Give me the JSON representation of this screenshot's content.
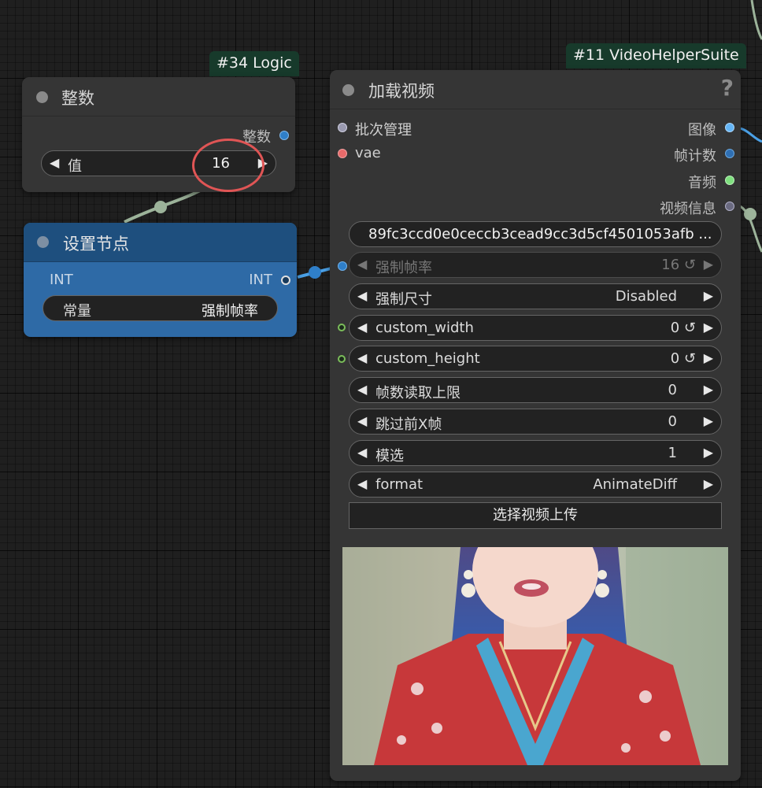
{
  "colors": {
    "canvas_bg": "#1f1f1f",
    "node_bg": "#353535",
    "blue_node_bg": "#2e6aa6",
    "tag_bg": "#173a2b",
    "link_int": "#9cb39a",
    "link_blue": "#4aa0e6",
    "highlight_circle": "#e05555"
  },
  "logic_node": {
    "tag": "#34 Logic",
    "title": "整数",
    "output_label": "整数",
    "widget": {
      "name": "值",
      "value": "16"
    }
  },
  "setter_node": {
    "title": "设置节点",
    "input_type": "INT",
    "output_type": "INT",
    "widget": {
      "name": "常量",
      "value": "强制帧率"
    }
  },
  "video_node": {
    "tag": "#11 VideoHelperSuite",
    "title": "加载视频",
    "help_icon": "?",
    "inputs": [
      {
        "label": "批次管理",
        "color": "#9a9ab0"
      },
      {
        "label": "vae",
        "color": "#e86a6a"
      }
    ],
    "outputs": [
      {
        "label": "图像",
        "color": "#64b5f6"
      },
      {
        "label": "帧计数",
        "color": "#3c7dc4"
      },
      {
        "label": "音频",
        "color": "#7fe07f"
      },
      {
        "label": "视频信息",
        "color": "#9a9ab0"
      }
    ],
    "video_field": "89fc3ccd0e0ceccb3cead9cc3d5cf4501053afb ...",
    "widgets": [
      {
        "name": "强制帧率",
        "value": "16",
        "reset": "↺",
        "dim": true,
        "slot": "blue"
      },
      {
        "name": "强制尺寸",
        "value": "Disabled",
        "reset": "",
        "dim": false,
        "slot": ""
      },
      {
        "name": "custom_width",
        "value": "0",
        "reset": "↺",
        "dim": false,
        "slot": "green"
      },
      {
        "name": "custom_height",
        "value": "0",
        "reset": "↺",
        "dim": false,
        "slot": "green"
      },
      {
        "name": "帧数读取上限",
        "value": "0",
        "reset": "",
        "dim": false,
        "slot": ""
      },
      {
        "name": "跳过前X帧",
        "value": "0",
        "reset": "",
        "dim": false,
        "slot": ""
      },
      {
        "name": "模选",
        "value": "1",
        "reset": "",
        "dim": false,
        "slot": ""
      },
      {
        "name": "format",
        "value": "AnimateDiff",
        "reset": "",
        "dim": false,
        "slot": ""
      }
    ],
    "upload_button": "选择视频上传"
  }
}
